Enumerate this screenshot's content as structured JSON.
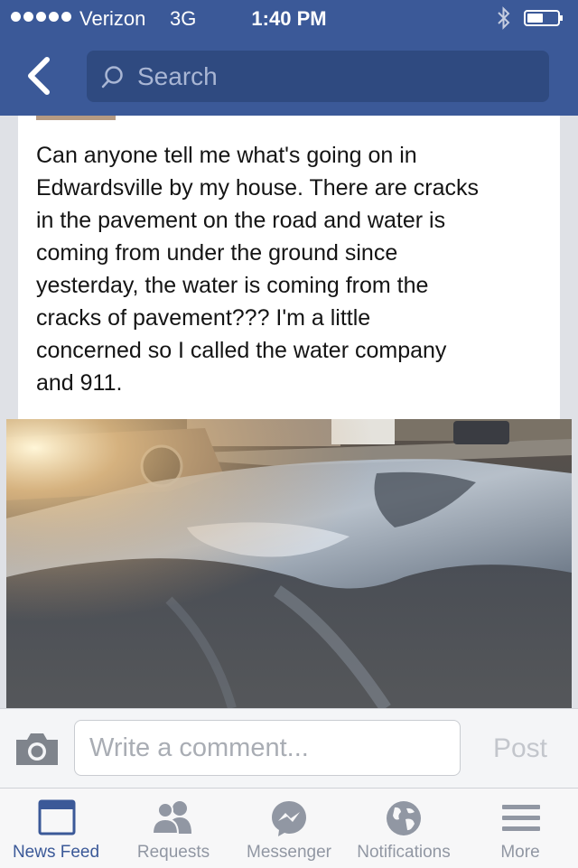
{
  "status_bar": {
    "carrier": "Verizon",
    "network": "3G",
    "time": "1:40 PM",
    "icons": [
      "signal-dots",
      "bluetooth-icon",
      "battery-icon"
    ]
  },
  "nav": {
    "back_icon": "chevron-left-icon",
    "search_placeholder": "Search"
  },
  "post": {
    "text": "Can anyone tell me what's going on in\nEdwardsville by my house. There are cracks\nin the pavement on the road and water is\ncoming from under the ground since\nyesterday, the water is coming from the\ncracks of pavement??? I'm a little\nconcerned so I called the water company\nand 911."
  },
  "comment_bar": {
    "camera_icon": "camera-icon",
    "placeholder": "Write a comment...",
    "post_label": "Post"
  },
  "tabs": [
    {
      "label": "News Feed",
      "icon": "news-feed-icon",
      "active": true
    },
    {
      "label": "Requests",
      "icon": "friends-icon",
      "active": false
    },
    {
      "label": "Messenger",
      "icon": "messenger-icon",
      "active": false
    },
    {
      "label": "Notifications",
      "icon": "globe-icon",
      "active": false
    },
    {
      "label": "More",
      "icon": "menu-icon",
      "active": false
    }
  ],
  "colors": {
    "brand": "#3b5998",
    "tab_inactive": "#9197a3",
    "post_disabled": "#c3c6cc"
  }
}
